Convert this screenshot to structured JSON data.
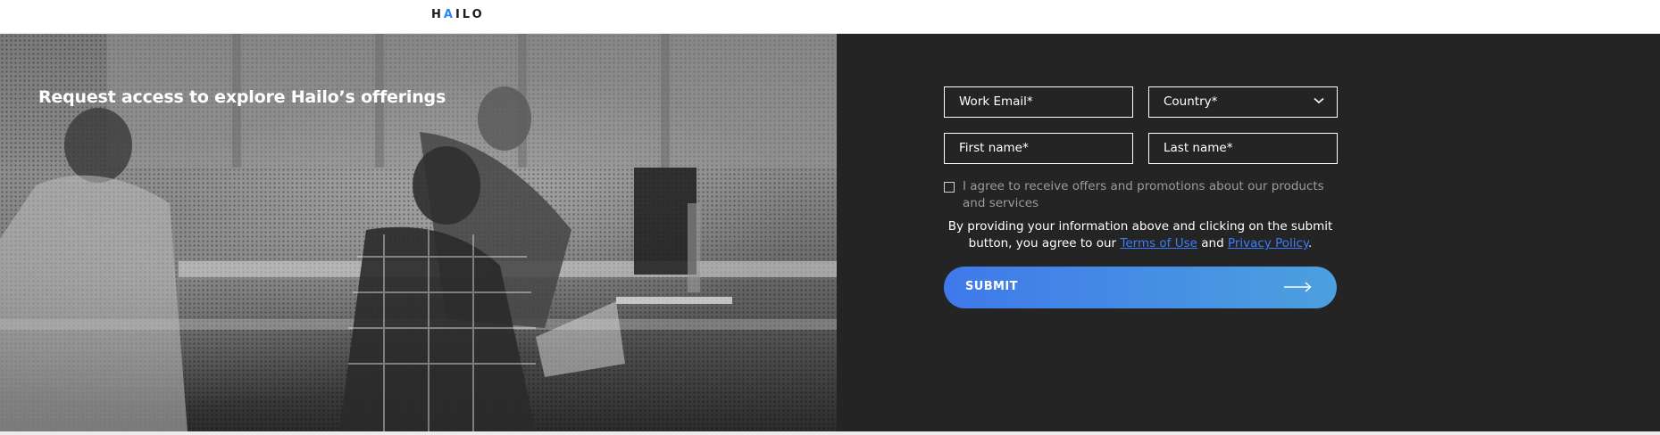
{
  "header": {
    "logo_text": "HAILO"
  },
  "hero": {
    "title": "Request access to explore Hailo’s offerings"
  },
  "form": {
    "work_email_placeholder": "Work Email*",
    "country_placeholder": "Country*",
    "first_name_placeholder": "First name*",
    "last_name_placeholder": "Last name*",
    "consent_label": "I agree to receive offers and promotions about our products and services",
    "legal_prefix": "By providing your information above and clicking on the submit button, you agree to our",
    "terms_link": "Terms of Use",
    "and_text": "and",
    "privacy_link": "Privacy Policy",
    "period": ".",
    "submit_label": "SUBMIT",
    "submit_icon": "arrow-right-icon",
    "country_icon": "chevron-down-icon"
  },
  "colors": {
    "panel_bg": "#242424",
    "accent_start": "#3f79ea",
    "accent_end": "#4ca0df",
    "link": "#3b7cff"
  }
}
